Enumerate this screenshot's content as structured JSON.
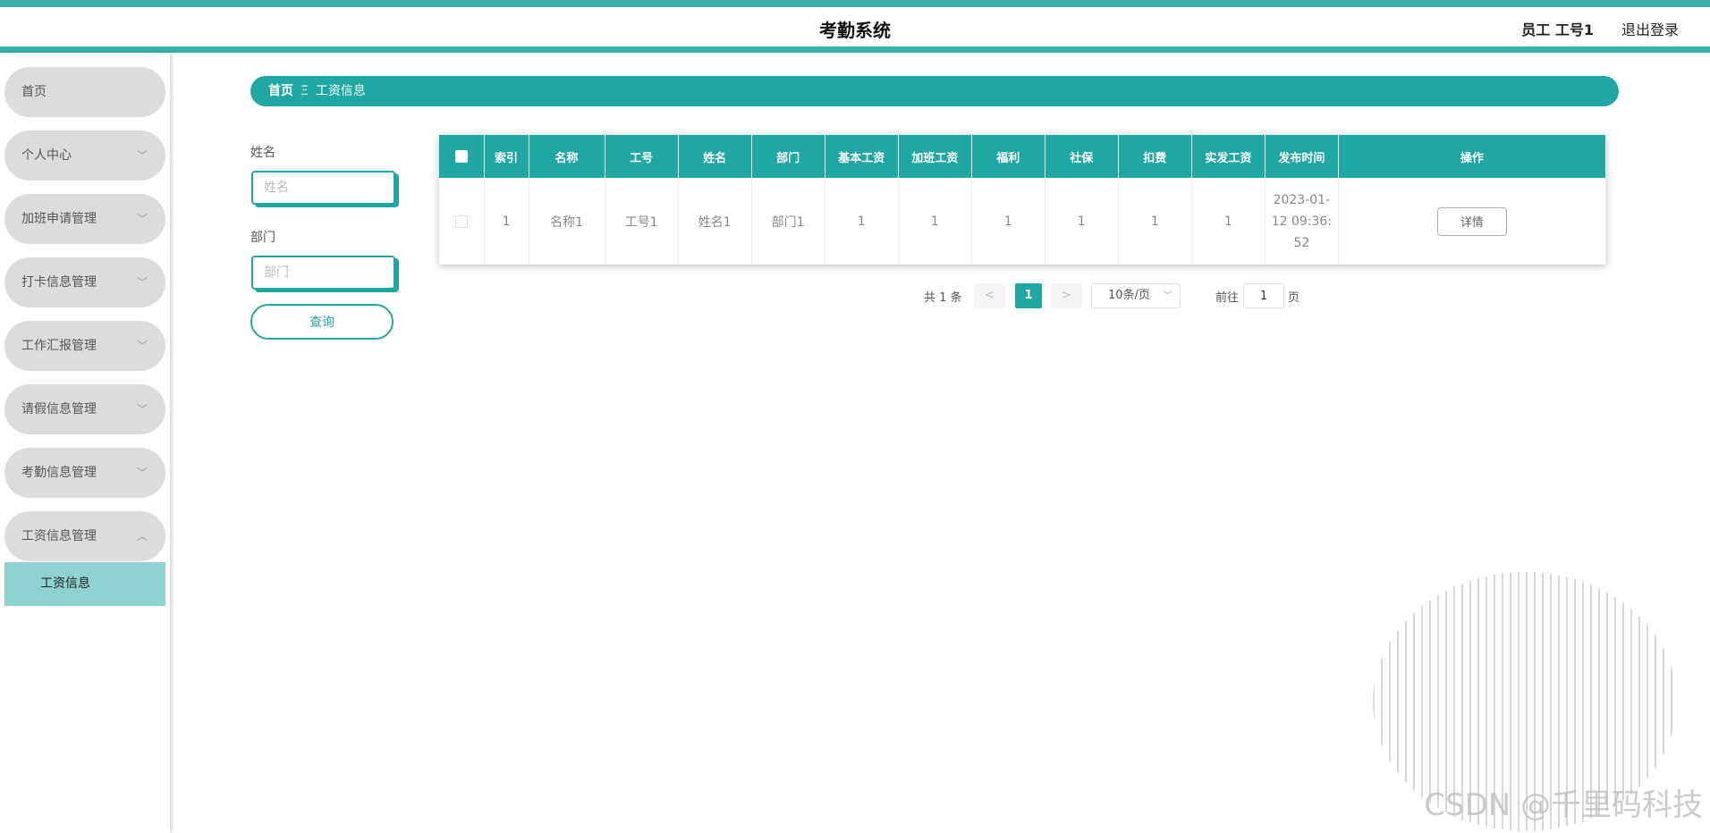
{
  "header": {
    "title": "考勤系统",
    "user": "员工 工号1",
    "logout": "退出登录"
  },
  "sidebar": {
    "items": [
      {
        "label": "首页"
      },
      {
        "label": "个人中心"
      },
      {
        "label": "加班申请管理"
      },
      {
        "label": "打卡信息管理"
      },
      {
        "label": "工作汇报管理"
      },
      {
        "label": "请假信息管理"
      },
      {
        "label": "考勤信息管理"
      },
      {
        "label": "工资信息管理"
      }
    ],
    "active_sub": "工资信息"
  },
  "breadcrumb": {
    "home": "首页",
    "separator": "Ξ",
    "current": "工资信息"
  },
  "search": {
    "name_label": "姓名",
    "name_placeholder": "姓名",
    "dept_label": "部门",
    "dept_placeholder": "部门",
    "query_button": "查询"
  },
  "table": {
    "headers": [
      "索引",
      "名称",
      "工号",
      "姓名",
      "部门",
      "基本工资",
      "加班工资",
      "福利",
      "社保",
      "扣费",
      "实发工资",
      "发布时间",
      "操作"
    ],
    "rows": [
      {
        "index": "1",
        "name": "名称1",
        "emp_no": "工号1",
        "person": "姓名1",
        "dept": "部门1",
        "base": "1",
        "overtime": "1",
        "welfare": "1",
        "social": "1",
        "deduct": "1",
        "actual": "1",
        "time": "2023-01-12 09:36:52",
        "action": "详情"
      }
    ]
  },
  "pagination": {
    "total": "共 1 条",
    "prev": "<",
    "current": "1",
    "next": ">",
    "page_size": "10条/页",
    "goto_label": "前往",
    "goto_value": "1",
    "page_suffix": "页"
  },
  "watermark": "CSDN @千里码科技",
  "colors": {
    "accent": "#1ea7a3",
    "topbar": "#3bb0ab",
    "menu_bg": "#dcdcdc",
    "active_sub_bg": "#8fd3d1"
  }
}
